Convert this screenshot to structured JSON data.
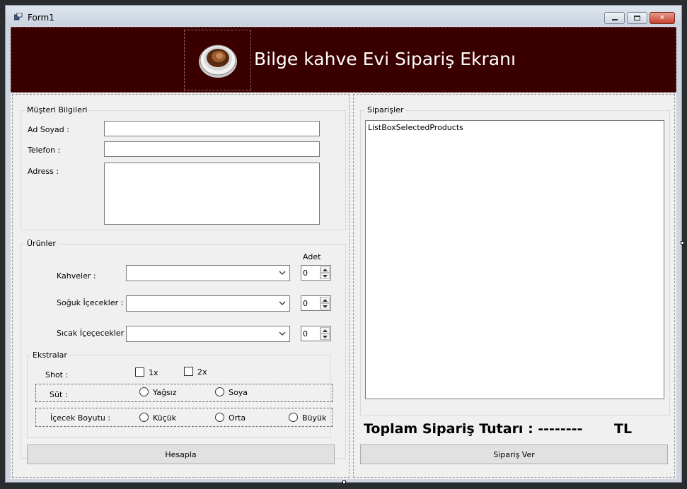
{
  "window": {
    "title": "Form1",
    "minimize_label": "",
    "maximize_label": "",
    "close_label": "✕"
  },
  "header": {
    "title": "Bilge kahve Evi Sipariş Ekranı"
  },
  "customer": {
    "group_label": "Müşteri Bilgileri",
    "name_label": "Ad Soyad :",
    "phone_label": "Telefon :",
    "address_label": "Adress :",
    "name_value": "",
    "phone_value": "",
    "address_value": ""
  },
  "products": {
    "group_label": "Ürünler",
    "qty_header": "Adet",
    "coffees_label": "Kahveler :",
    "cold_label": "Soğuk İçecekler :",
    "hot_label": "Sıcak İçeçecekler :",
    "coffees_value": "",
    "cold_value": "",
    "hot_value": "",
    "coffees_qty": "0",
    "cold_qty": "0",
    "hot_qty": "0"
  },
  "extras": {
    "group_label": "Ekstralar",
    "shot_label": "Shot :",
    "shot_1x": "1x",
    "shot_2x": "2x",
    "milk_label": "Süt :",
    "milk_skim": "Yağsız",
    "milk_soy": "Soya",
    "size_label": "İçecek  Boyutu :",
    "size_small": "Küçük",
    "size_medium": "Orta",
    "size_large": "Büyük"
  },
  "calculate_button": "Hesapla",
  "orders": {
    "group_label": "Siparişler",
    "listbox_text": "ListBoxSelectedProducts"
  },
  "total": {
    "label": "Toplam Sipariş Tutarı : --------",
    "currency": "TL"
  },
  "order_button": "Sipariş Ver",
  "colors": {
    "header_bg": "#3a0000",
    "header_text": "#ffffff",
    "form_bg": "#f0f0f0"
  }
}
